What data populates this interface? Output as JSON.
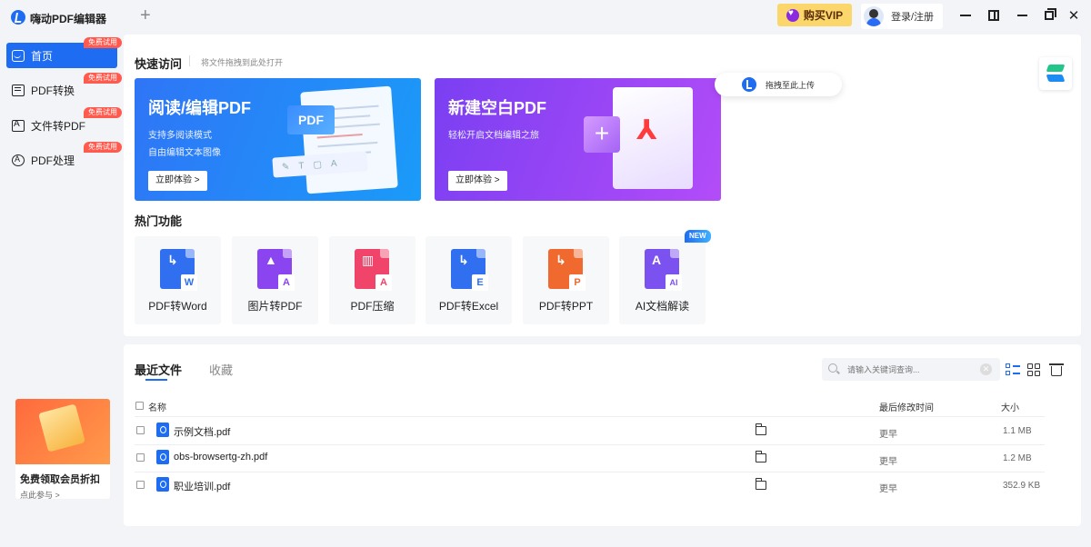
{
  "app": {
    "title": "嗨动PDF编辑器",
    "new_tab": "+"
  },
  "header": {
    "vip_label": "购买VIP",
    "login_label": "登录/注册"
  },
  "sidebar": {
    "items": [
      {
        "label": "首页",
        "badge": "免费试用"
      },
      {
        "label": "PDF转换",
        "badge": "免费试用"
      },
      {
        "label": "文件转PDF",
        "badge": "免费试用"
      },
      {
        "label": "PDF处理",
        "badge": "免费试用"
      }
    ],
    "promo": {
      "title": "免费领取会员折扣",
      "link": "点此参与 >"
    }
  },
  "quick_access": {
    "title": "快速访问",
    "hint": "将文件拖拽到此处打开",
    "upload_label": "拖拽至此上传",
    "cards": [
      {
        "title": "阅读/编辑PDF",
        "sub1": "支持多阅读模式",
        "sub2": "自由编辑文本图像",
        "button": "立即体验 >",
        "chip": "PDF"
      },
      {
        "title": "新建空白PDF",
        "sub1": "轻松开启文档编辑之旅",
        "button": "立即体验 >"
      }
    ]
  },
  "hot": {
    "title": "热门功能",
    "new_badge": "NEW",
    "features": [
      {
        "label": "PDF转Word",
        "icon": "pdf-to-word-icon",
        "sub": "W",
        "color": "#2f6ff0",
        "subcolor": "#2f6ff0"
      },
      {
        "label": "图片转PDF",
        "icon": "image-to-pdf-icon",
        "sub": "A",
        "color": "#8a45f0",
        "subcolor": "#8a45f0"
      },
      {
        "label": "PDF压缩",
        "icon": "pdf-compress-icon",
        "sub": "A",
        "color": "#f0446a",
        "subcolor": "#f0446a"
      },
      {
        "label": "PDF转Excel",
        "icon": "pdf-to-excel-icon",
        "sub": "E",
        "color": "#2f6ff0",
        "subcolor": "#2f6ff0"
      },
      {
        "label": "PDF转PPT",
        "icon": "pdf-to-ppt-icon",
        "sub": "P",
        "color": "#f06a2f",
        "subcolor": "#f06a2f"
      },
      {
        "label": "AI文档解读",
        "icon": "ai-document-icon",
        "sub": "AI",
        "color": "#7b52f0",
        "subcolor": "#7b52f0"
      }
    ]
  },
  "recent": {
    "tab_recent": "最近文件",
    "tab_fav": "收藏",
    "search_placeholder": "请输入关键词查询...",
    "columns": {
      "name": "名称",
      "modified": "最后修改时间",
      "size": "大小"
    },
    "files": [
      {
        "name": "示例文档.pdf",
        "modified": "更早",
        "size": "1.1 MB"
      },
      {
        "name": "obs-browsertg-zh.pdf",
        "modified": "更早",
        "size": "1.2 MB"
      },
      {
        "name": "职业培训.pdf",
        "modified": "更早",
        "size": "352.9 KB"
      }
    ]
  },
  "colors": {
    "accent": "#1d6cf2",
    "vip": "#fbd66a",
    "badge": "#ff5a4e"
  }
}
